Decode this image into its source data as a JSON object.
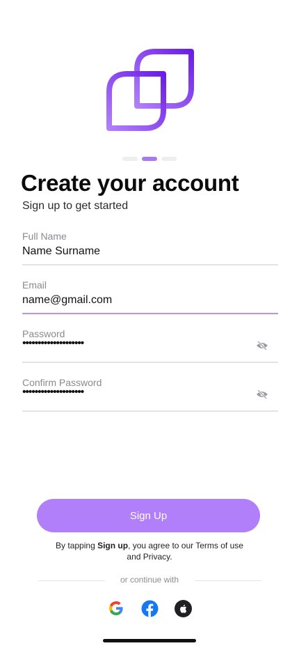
{
  "onboarding": {
    "step_count": 3,
    "active_step": 2
  },
  "header": {
    "title": "Create your account",
    "subtitle": "Sign up to get started"
  },
  "form": {
    "full_name": {
      "label": "Full Name",
      "value": "Name Surname"
    },
    "email": {
      "label": "Email",
      "value": "name@gmail.com"
    },
    "password": {
      "label": "Password",
      "value": "••••••••••••••••••••"
    },
    "confirm_password": {
      "label": "Confirm Password",
      "value": "••••••••••••••••••••"
    }
  },
  "actions": {
    "signup_label": "Sign Up"
  },
  "terms": {
    "prefix": "By tapping ",
    "bold": "Sign up",
    "line1_rest": ", you agree to our Terms of use",
    "line2": "and Privacy."
  },
  "divider": {
    "text": "or continue with"
  },
  "social": [
    "google-icon",
    "facebook-icon",
    "apple-icon"
  ],
  "colors": {
    "accent": "#a978f2",
    "button": "#b07ff9",
    "logo_start": "#6d1ee6",
    "logo_end": "#b07ff9",
    "focus_underline": "#b595e8"
  }
}
